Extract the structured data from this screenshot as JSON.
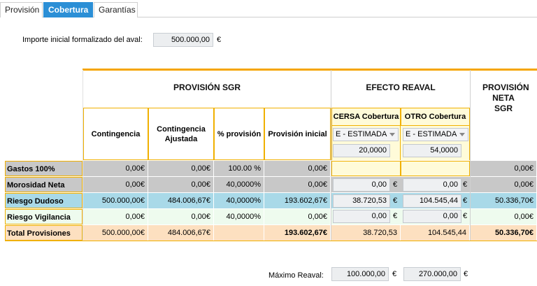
{
  "tabs": [
    {
      "label": "Provisión"
    },
    {
      "label": "Cobertura"
    },
    {
      "label": "Garantías"
    }
  ],
  "importe": {
    "label": "Importe inicial formalizado del aval:",
    "value": "500.000,00",
    "currency": "€"
  },
  "headers": {
    "provision_sgr": "PROVISIÓN SGR",
    "efecto_reaval": "EFECTO REAVAL",
    "provision_neta": "PROVISIÓN NETA SGR",
    "contingencia": "Contingencia",
    "contingencia_ajustada": "Contingencia Ajustada",
    "pct_provision": "% provisión",
    "provision_inicial": "Provisión inicial",
    "cersa": "CERSA Cobertura",
    "otro": "OTRO  Cobertura"
  },
  "cobertura": {
    "cersa_select": "E - ESTIMADA",
    "otro_select": "E - ESTIMADA",
    "cersa_pct": "20,0000",
    "otro_pct": "54,0000"
  },
  "rows": [
    {
      "label": "Gastos 100%",
      "contingencia": "0,00€",
      "ajustada": "0,00€",
      "pct": "100.00 %",
      "inicial": "0,00€",
      "cersa": "",
      "otro": "",
      "neta": "0,00€"
    },
    {
      "label": "Morosidad Neta",
      "contingencia": "0,00€",
      "ajustada": "0,00€",
      "pct": "40,0000%",
      "inicial": "0,00€",
      "cersa": "0,00",
      "otro": "0,00",
      "neta": "0,00€"
    },
    {
      "label": "Riesgo Dudoso",
      "contingencia": "500.000,00€",
      "ajustada": "484.006,67€",
      "pct": "40,0000%",
      "inicial": "193.602,67€",
      "cersa": "38.720,53",
      "otro": "104.545,44",
      "neta": "50.336,70€"
    },
    {
      "label": "Riesgo Vigilancia",
      "contingencia": "0,00€",
      "ajustada": "0,00€",
      "pct": "40,0000%",
      "inicial": "0,00€",
      "cersa": "0,00",
      "otro": "0,00",
      "neta": "0,00€"
    },
    {
      "label": "Total Provisiones",
      "contingencia": "500.000,00€",
      "ajustada": "484.006,67€",
      "pct": "",
      "inicial": "193.602,67€",
      "cersa": "38.720,53",
      "otro": "104.545,44",
      "neta": "50.336,70€"
    }
  ],
  "euro_sign": "€",
  "maximo": {
    "label": "Máximo Reaval:",
    "cersa": "100.000,00",
    "otro": "270.000,00",
    "currency": "€"
  },
  "colors": {
    "accent": "#f5a500",
    "tab_active": "#2b8fd6",
    "gray_row": "#c8c8c8",
    "blue_row": "#a9d9e8",
    "green_row": "#eefbee",
    "total_row": "#fde0c0",
    "reaval_bg": "#fffbd9"
  }
}
